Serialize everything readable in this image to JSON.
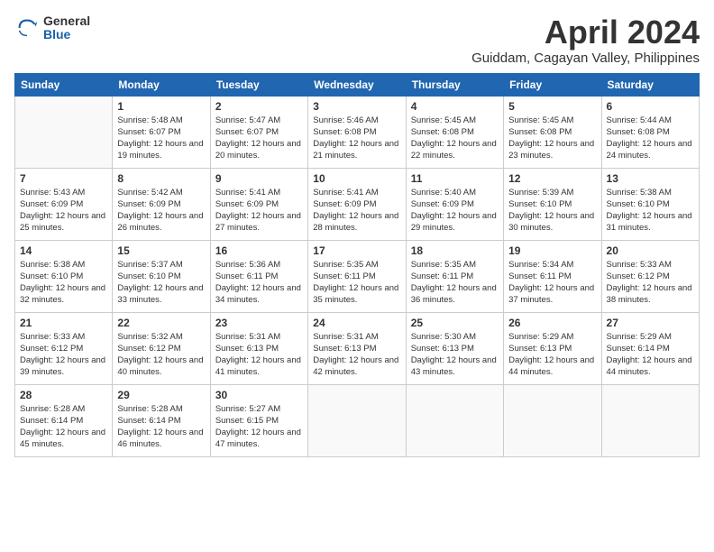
{
  "logo": {
    "general": "General",
    "blue": "Blue"
  },
  "title": "April 2024",
  "subtitle": "Guiddam, Cagayan Valley, Philippines",
  "weekdays": [
    "Sunday",
    "Monday",
    "Tuesday",
    "Wednesday",
    "Thursday",
    "Friday",
    "Saturday"
  ],
  "weeks": [
    [
      {
        "day": "",
        "sunrise": "",
        "sunset": "",
        "daylight": ""
      },
      {
        "day": "1",
        "sunrise": "Sunrise: 5:48 AM",
        "sunset": "Sunset: 6:07 PM",
        "daylight": "Daylight: 12 hours and 19 minutes."
      },
      {
        "day": "2",
        "sunrise": "Sunrise: 5:47 AM",
        "sunset": "Sunset: 6:07 PM",
        "daylight": "Daylight: 12 hours and 20 minutes."
      },
      {
        "day": "3",
        "sunrise": "Sunrise: 5:46 AM",
        "sunset": "Sunset: 6:08 PM",
        "daylight": "Daylight: 12 hours and 21 minutes."
      },
      {
        "day": "4",
        "sunrise": "Sunrise: 5:45 AM",
        "sunset": "Sunset: 6:08 PM",
        "daylight": "Daylight: 12 hours and 22 minutes."
      },
      {
        "day": "5",
        "sunrise": "Sunrise: 5:45 AM",
        "sunset": "Sunset: 6:08 PM",
        "daylight": "Daylight: 12 hours and 23 minutes."
      },
      {
        "day": "6",
        "sunrise": "Sunrise: 5:44 AM",
        "sunset": "Sunset: 6:08 PM",
        "daylight": "Daylight: 12 hours and 24 minutes."
      }
    ],
    [
      {
        "day": "7",
        "sunrise": "Sunrise: 5:43 AM",
        "sunset": "Sunset: 6:09 PM",
        "daylight": "Daylight: 12 hours and 25 minutes."
      },
      {
        "day": "8",
        "sunrise": "Sunrise: 5:42 AM",
        "sunset": "Sunset: 6:09 PM",
        "daylight": "Daylight: 12 hours and 26 minutes."
      },
      {
        "day": "9",
        "sunrise": "Sunrise: 5:41 AM",
        "sunset": "Sunset: 6:09 PM",
        "daylight": "Daylight: 12 hours and 27 minutes."
      },
      {
        "day": "10",
        "sunrise": "Sunrise: 5:41 AM",
        "sunset": "Sunset: 6:09 PM",
        "daylight": "Daylight: 12 hours and 28 minutes."
      },
      {
        "day": "11",
        "sunrise": "Sunrise: 5:40 AM",
        "sunset": "Sunset: 6:09 PM",
        "daylight": "Daylight: 12 hours and 29 minutes."
      },
      {
        "day": "12",
        "sunrise": "Sunrise: 5:39 AM",
        "sunset": "Sunset: 6:10 PM",
        "daylight": "Daylight: 12 hours and 30 minutes."
      },
      {
        "day": "13",
        "sunrise": "Sunrise: 5:38 AM",
        "sunset": "Sunset: 6:10 PM",
        "daylight": "Daylight: 12 hours and 31 minutes."
      }
    ],
    [
      {
        "day": "14",
        "sunrise": "Sunrise: 5:38 AM",
        "sunset": "Sunset: 6:10 PM",
        "daylight": "Daylight: 12 hours and 32 minutes."
      },
      {
        "day": "15",
        "sunrise": "Sunrise: 5:37 AM",
        "sunset": "Sunset: 6:10 PM",
        "daylight": "Daylight: 12 hours and 33 minutes."
      },
      {
        "day": "16",
        "sunrise": "Sunrise: 5:36 AM",
        "sunset": "Sunset: 6:11 PM",
        "daylight": "Daylight: 12 hours and 34 minutes."
      },
      {
        "day": "17",
        "sunrise": "Sunrise: 5:35 AM",
        "sunset": "Sunset: 6:11 PM",
        "daylight": "Daylight: 12 hours and 35 minutes."
      },
      {
        "day": "18",
        "sunrise": "Sunrise: 5:35 AM",
        "sunset": "Sunset: 6:11 PM",
        "daylight": "Daylight: 12 hours and 36 minutes."
      },
      {
        "day": "19",
        "sunrise": "Sunrise: 5:34 AM",
        "sunset": "Sunset: 6:11 PM",
        "daylight": "Daylight: 12 hours and 37 minutes."
      },
      {
        "day": "20",
        "sunrise": "Sunrise: 5:33 AM",
        "sunset": "Sunset: 6:12 PM",
        "daylight": "Daylight: 12 hours and 38 minutes."
      }
    ],
    [
      {
        "day": "21",
        "sunrise": "Sunrise: 5:33 AM",
        "sunset": "Sunset: 6:12 PM",
        "daylight": "Daylight: 12 hours and 39 minutes."
      },
      {
        "day": "22",
        "sunrise": "Sunrise: 5:32 AM",
        "sunset": "Sunset: 6:12 PM",
        "daylight": "Daylight: 12 hours and 40 minutes."
      },
      {
        "day": "23",
        "sunrise": "Sunrise: 5:31 AM",
        "sunset": "Sunset: 6:13 PM",
        "daylight": "Daylight: 12 hours and 41 minutes."
      },
      {
        "day": "24",
        "sunrise": "Sunrise: 5:31 AM",
        "sunset": "Sunset: 6:13 PM",
        "daylight": "Daylight: 12 hours and 42 minutes."
      },
      {
        "day": "25",
        "sunrise": "Sunrise: 5:30 AM",
        "sunset": "Sunset: 6:13 PM",
        "daylight": "Daylight: 12 hours and 43 minutes."
      },
      {
        "day": "26",
        "sunrise": "Sunrise: 5:29 AM",
        "sunset": "Sunset: 6:13 PM",
        "daylight": "Daylight: 12 hours and 44 minutes."
      },
      {
        "day": "27",
        "sunrise": "Sunrise: 5:29 AM",
        "sunset": "Sunset: 6:14 PM",
        "daylight": "Daylight: 12 hours and 44 minutes."
      }
    ],
    [
      {
        "day": "28",
        "sunrise": "Sunrise: 5:28 AM",
        "sunset": "Sunset: 6:14 PM",
        "daylight": "Daylight: 12 hours and 45 minutes."
      },
      {
        "day": "29",
        "sunrise": "Sunrise: 5:28 AM",
        "sunset": "Sunset: 6:14 PM",
        "daylight": "Daylight: 12 hours and 46 minutes."
      },
      {
        "day": "30",
        "sunrise": "Sunrise: 5:27 AM",
        "sunset": "Sunset: 6:15 PM",
        "daylight": "Daylight: 12 hours and 47 minutes."
      },
      {
        "day": "",
        "sunrise": "",
        "sunset": "",
        "daylight": ""
      },
      {
        "day": "",
        "sunrise": "",
        "sunset": "",
        "daylight": ""
      },
      {
        "day": "",
        "sunrise": "",
        "sunset": "",
        "daylight": ""
      },
      {
        "day": "",
        "sunrise": "",
        "sunset": "",
        "daylight": ""
      }
    ]
  ]
}
